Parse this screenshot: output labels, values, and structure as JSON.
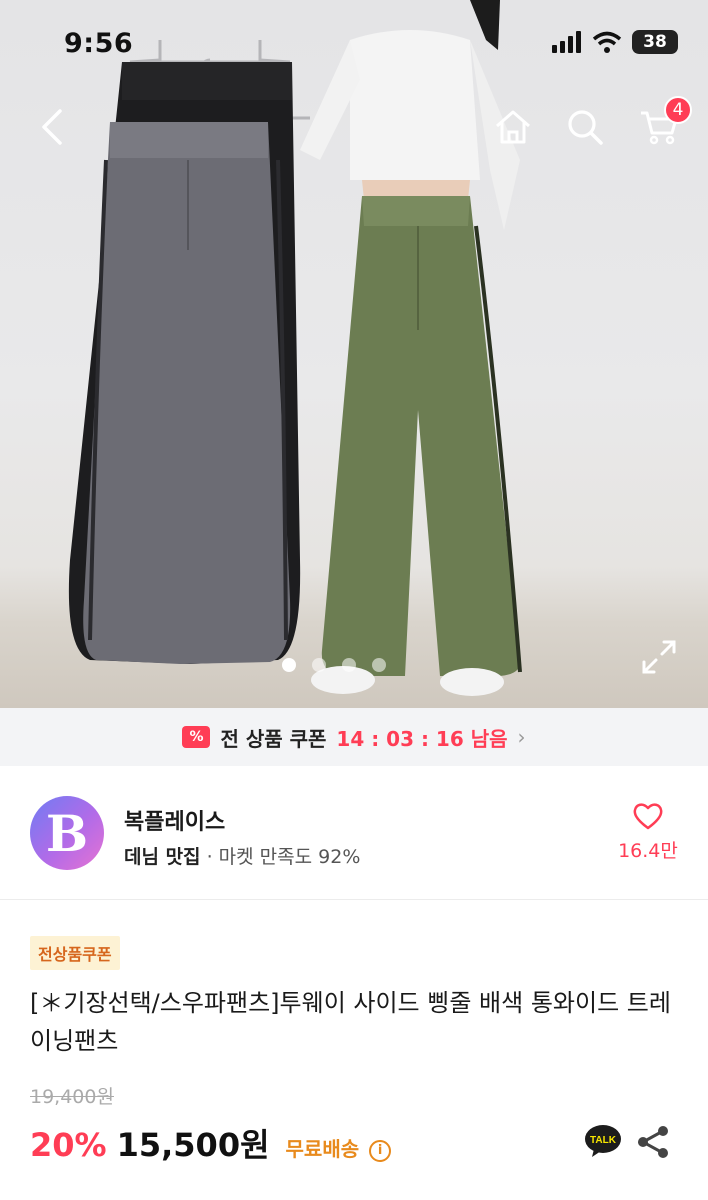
{
  "status_bar": {
    "time": "9:56",
    "battery": "38"
  },
  "nav": {
    "cart_count": "4"
  },
  "gallery": {
    "dot_count": 4,
    "active_index": 0
  },
  "coupon_bar": {
    "label": "전 상품 쿠폰",
    "timer": "14 : 03 : 16 남음"
  },
  "store": {
    "logo_letter": "B",
    "name": "복플레이스",
    "category": "데님 맛집",
    "satisfaction": " · 마켓 만족도 92%",
    "likes": "16.4만"
  },
  "product": {
    "tag": "전상품쿠폰",
    "title": "[＊기장선택/스우파팬츠]투웨이 사이드 삥줄 배색 통와이드 트레이닝팬츠",
    "original_price": "19,400원",
    "discount": "20%",
    "price": "15,500원",
    "shipping": "무료배송"
  },
  "colors": {
    "accent": "#ff3d55",
    "shipping": "#e88a1c",
    "tag_bg": "#fdf2d4"
  },
  "icons": [
    "chevron-left-icon",
    "home-icon",
    "search-icon",
    "cart-icon",
    "expand-icon",
    "coupon-icon",
    "heart-icon",
    "info-icon",
    "kakao-talk-icon",
    "share-icon"
  ]
}
